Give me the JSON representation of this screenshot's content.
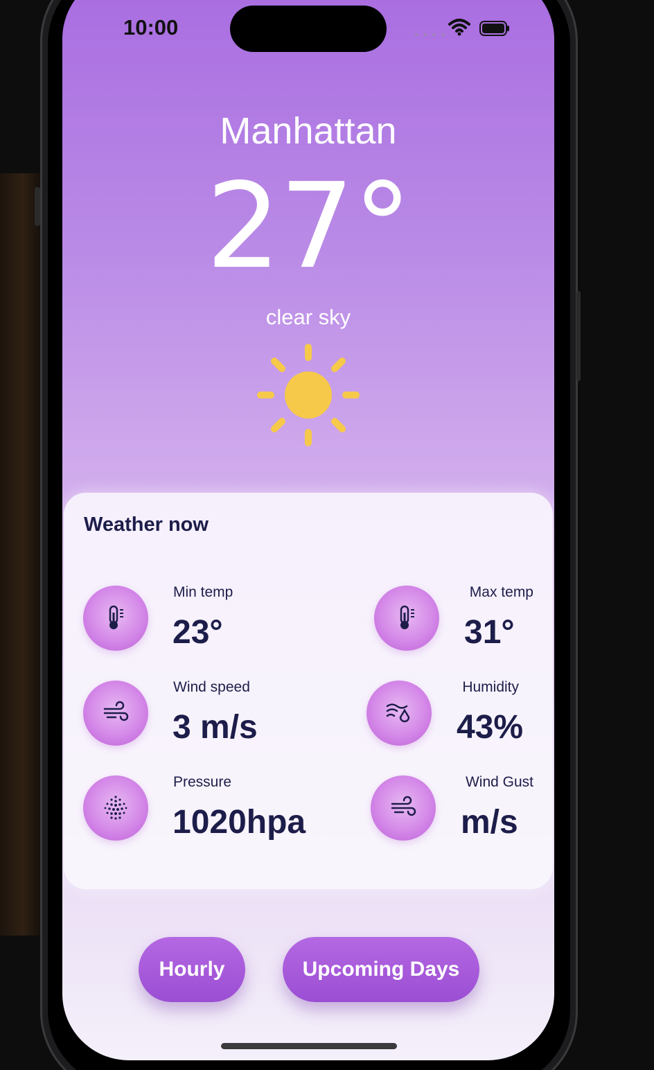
{
  "status_bar": {
    "time": "10:00"
  },
  "weather": {
    "city": "Manhattan",
    "temperature": "27°",
    "description": "clear sky",
    "icon": "sun-icon"
  },
  "card": {
    "title": "Weather now",
    "metrics": [
      {
        "label": "Min temp",
        "value": "23°",
        "icon": "thermometer-icon"
      },
      {
        "label": "Max temp",
        "value": "31°",
        "icon": "thermometer-icon"
      },
      {
        "label": "Wind speed",
        "value": "3 m/s",
        "icon": "wind-icon"
      },
      {
        "label": "Humidity",
        "value": "43%",
        "icon": "humidity-icon"
      },
      {
        "label": "Pressure",
        "value": "1020hpa",
        "icon": "pressure-icon"
      },
      {
        "label": "Wind Gust",
        "value": "m/s",
        "icon": "wind-icon"
      }
    ]
  },
  "buttons": {
    "hourly": "Hourly",
    "upcoming_days": "Upcoming Days"
  },
  "colors": {
    "gradient_top": "#a86be0",
    "gradient_bottom": "#f4f0fa",
    "accent": "#9b4ed3",
    "text_dark": "#1d1d4a",
    "sun": "#f6c94a"
  }
}
